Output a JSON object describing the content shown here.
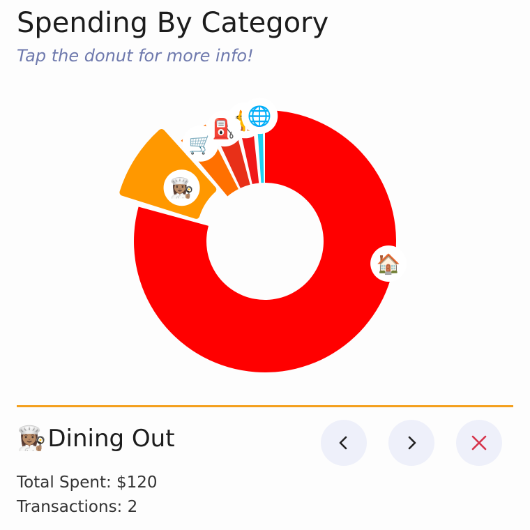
{
  "header": {
    "title": "Spending By Category",
    "subtitle": "Tap the donut for more info!"
  },
  "chart_data": {
    "type": "donut",
    "unit": "$",
    "selected_index": 1,
    "series": [
      {
        "name": "Housing",
        "icon": "house-icon",
        "emoji": "🏠",
        "value": 1050,
        "color": "#ff0000"
      },
      {
        "name": "Dining Out",
        "icon": "chef-icon",
        "emoji": "👩🏽‍🍳",
        "value": 120,
        "color": "#ff9800"
      },
      {
        "name": "Groceries",
        "icon": "shopping-cart-icon",
        "emoji": "🛒",
        "value": 55,
        "color": "#ff7000"
      },
      {
        "name": "Gas",
        "icon": "fuel-pump-icon",
        "emoji": "⛽",
        "value": 45,
        "color": "#e83018"
      },
      {
        "name": "Pets",
        "icon": "cat-icon",
        "emoji": "🐈",
        "value": 32,
        "color": "#f01818"
      },
      {
        "name": "Internet",
        "icon": "globe-icon",
        "emoji": "🌐",
        "value": 18,
        "color": "#1ed0f2"
      }
    ]
  },
  "detail": {
    "emoji": "👩🏽‍🍳",
    "name": "Dining Out",
    "total_label": "Total Spent: $120",
    "transactions_label": "Transactions: 2",
    "accent_color": "#f4a01e"
  },
  "controls": {
    "prev_icon": "chevron-left-icon",
    "next_icon": "chevron-right-icon",
    "close_icon": "close-icon",
    "close_color": "#d6334a"
  }
}
